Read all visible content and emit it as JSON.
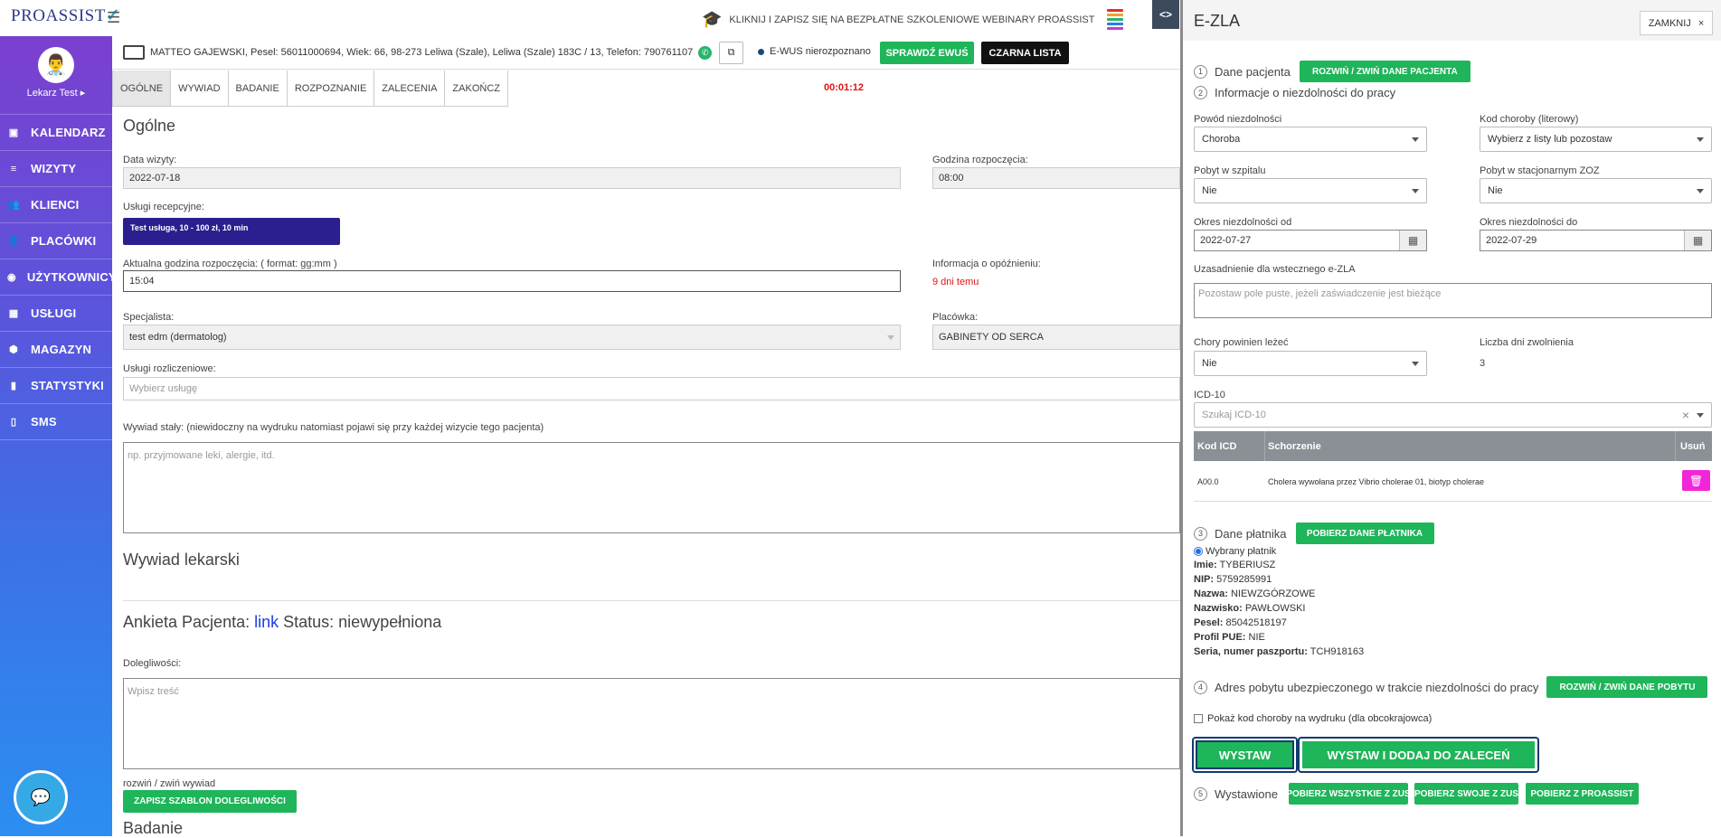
{
  "header": {
    "logo": "PROASSIST",
    "announcement": "KLIKNIJ I ZAPISZ SIĘ NA BEZPŁATNE SZKOLENIOWE WEBINARY PROASSIST",
    "bars_colors": [
      "#e0312d",
      "#f0a030",
      "#2ab36a",
      "#2a7de0",
      "#c03fd0"
    ]
  },
  "sidebar": {
    "username": "Lekarz Test",
    "items": [
      {
        "label": "KALENDARZ",
        "icon": "calendar-icon"
      },
      {
        "label": "WIZYTY",
        "icon": "list-icon"
      },
      {
        "label": "KLIENCI",
        "icon": "users-icon"
      },
      {
        "label": "PLACÓWKI",
        "icon": "building-user-icon"
      },
      {
        "label": "UŻYTKOWNICY",
        "icon": "user-icon"
      },
      {
        "label": "USŁUGI",
        "icon": "grid-icon"
      },
      {
        "label": "MAGAZYN",
        "icon": "box-icon"
      },
      {
        "label": "STATYSTYKI",
        "icon": "chart-icon"
      },
      {
        "label": "SMS",
        "icon": "phone-icon"
      }
    ]
  },
  "patient": {
    "info": "MATTEO GAJEWSKI, Pesel: 56011000694, Wiek: 66, 98-273 Leliwa (Szale), Leliwa (Szale) 183C / 13, Telefon: 790761107",
    "ewus_status": "E-WUS nierozpoznano",
    "check_ewus": "SPRAWDŹ EWUŚ",
    "blacklist": "CZARNA LISTA"
  },
  "tabs": [
    "OGÓLNE",
    "WYWIAD",
    "BADANIE",
    "ROZPOZNANIE",
    "ZALECENIA",
    "ZAKOŃCZ"
  ],
  "timer": "00:01:12",
  "main": {
    "title": "Ogólne",
    "visit_date_label": "Data wizyty:",
    "visit_date": "2022-07-18",
    "start_time_label": "Godzina rozpoczęcia:",
    "start_time": "08:00",
    "reception_services_label": "Usługi recepcyjne:",
    "reception_service": "Test usługa, 10 - 100 zł, 10 min",
    "current_time_label": "Aktualna godzina rozpoczęcia: ( format: gg:mm )",
    "current_time": "15:04",
    "delay_label": "Informacja o opóźnieniu:",
    "delay_value": "9 dni temu",
    "specialist_label": "Specjalista:",
    "specialist": "test edm (dermatolog)",
    "facility_label": "Placówka:",
    "facility": "GABINETY OD SERCA",
    "billing_label": "Usługi rozliczeniowe:",
    "billing_placeholder": "Wybierz usługę",
    "permanent_history_label": "Wywiad stały: (niewidoczny na wydruku natomiast pojawi się przy każdej wizycie tego pacjenta)",
    "permanent_history_placeholder": "np. przyjmowane leki, alergie, itd.",
    "medical_history_title": "Wywiad lekarski",
    "survey_title_prefix": "Ankieta Pacjenta:",
    "survey_link": "link",
    "survey_status": "Status: niewypełniona",
    "complaints_label": "Dolegliwości:",
    "complaints_placeholder": "Wpisz treść",
    "toggle_history": "rozwiń / zwiń wywiad",
    "save_template": "ZAPISZ SZABLON DOLEGLIWOŚCI",
    "exam_title": "Badanie"
  },
  "ezla": {
    "title": "E-ZLA",
    "close": "ZAMKNIJ",
    "close_x": "×",
    "section1": {
      "num": "1",
      "title": "Dane pacjenta",
      "button": "ROZWIŃ / ZWIŃ DANE PACJENTA"
    },
    "section2": {
      "num": "2",
      "title": "Informacje o niezdolności do pracy"
    },
    "reason_label": "Powód niezdolności",
    "reason": "Choroba",
    "disease_code_label": "Kod choroby (literowy)",
    "disease_code": "Wybierz z listy lub pozostaw",
    "hospital_label": "Pobyt w szpitalu",
    "hospital": "Nie",
    "zoz_label": "Pobyt w stacjonarnym ZOZ",
    "zoz": "Nie",
    "from_label": "Okres niezdolności od",
    "from": "2022-07-27",
    "to_label": "Okres niezdolności do",
    "to": "2022-07-29",
    "justification_label": "Uzasadnienie dla wstecznego e-ZLA",
    "justification_placeholder": "Pozostaw pole puste, jeżeli zaświadczenie jest bieżące",
    "lying_label": "Chory powinien leżeć",
    "lying": "Nie",
    "days_label": "Liczba dni zwolnienia",
    "days": "3",
    "icd_label": "ICD-10",
    "icd_placeholder": "Szukaj ICD-10",
    "icd_clear": "×",
    "icd_columns": [
      "Kod ICD",
      "Schorzenie",
      "Usuń"
    ],
    "icd_rows": [
      {
        "code": "A00.0",
        "name": "Cholera wywołana przez Vibrio cholerae 01, biotyp cholerae"
      }
    ],
    "section3": {
      "num": "3",
      "title": "Dane płatnika",
      "button": "POBIERZ DANE PŁATNIKA"
    },
    "payer_radio": "Wybrany płatnik",
    "payer": [
      {
        "k": "Imie:",
        "v": "TYBERIUSZ"
      },
      {
        "k": "NIP:",
        "v": "5759285991"
      },
      {
        "k": "Nazwa:",
        "v": "NIEWZGÓRZOWE"
      },
      {
        "k": "Nazwisko:",
        "v": "PAWŁOWSKI"
      },
      {
        "k": "Pesel:",
        "v": "85042518197"
      },
      {
        "k": "Profil PUE:",
        "v": "NIE"
      },
      {
        "k": "Seria, numer paszportu:",
        "v": "TCH918163"
      }
    ],
    "section4": {
      "num": "4",
      "title": "Adres pobytu ubezpieczonego w trakcie niezdolności do pracy",
      "button": "ROZWIŃ / ZWIŃ DANE POBYTU"
    },
    "show_code_checkbox": "Pokaż kod choroby na wydruku (dla obcokrajowca)",
    "issue": "WYSTAW",
    "issue_add": "WYSTAW I DODAJ DO ZALECEŃ",
    "section5": {
      "num": "5",
      "title": "Wystawione"
    },
    "fetch_all": "POBIERZ WSZYSTKIE Z ZUS",
    "fetch_own": "POBIERZ SWOJE Z ZUS",
    "fetch_proassist": "POBIERZ Z PROASSIST"
  }
}
